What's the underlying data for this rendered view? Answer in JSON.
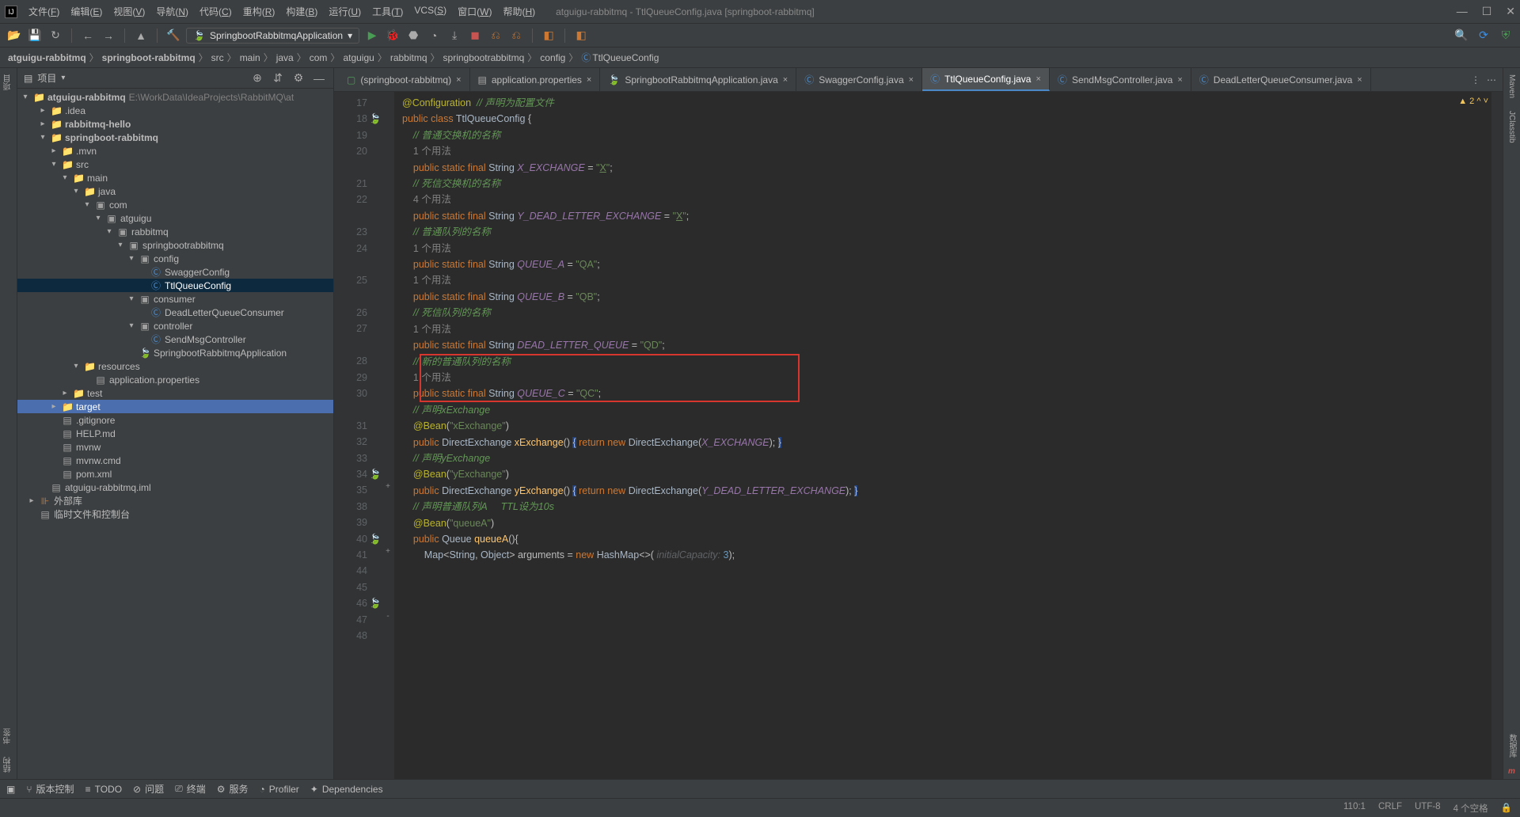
{
  "window": {
    "title": "atguigu-rabbitmq - TtlQueueConfig.java [springboot-rabbitmq]"
  },
  "menus": [
    "文件(F)",
    "编辑(E)",
    "视图(V)",
    "导航(N)",
    "代码(C)",
    "重构(R)",
    "构建(B)",
    "运行(U)",
    "工具(T)",
    "VCS(S)",
    "窗口(W)",
    "帮助(H)"
  ],
  "run_config": "SpringbootRabbitmqApplication",
  "breadcrumb": [
    "atguigu-rabbitmq",
    "springboot-rabbitmq",
    "src",
    "main",
    "java",
    "com",
    "atguigu",
    "rabbitmq",
    "springbootrabbitmq",
    "config",
    "TtlQueueConfig"
  ],
  "left_rail": [
    "项目"
  ],
  "right_rail_top": [
    "Maven",
    "JClasstib"
  ],
  "right_rail_bottom": [
    "数据库",
    "m"
  ],
  "left_rail_bottom": [
    "书签",
    "结构"
  ],
  "tree_title": "项目",
  "tree": {
    "root": {
      "name": "atguigu-rabbitmq",
      "path": "E:\\WorkData\\IdeaProjects\\RabbitMQ\\at"
    },
    "items": [
      {
        "pad": 1,
        "arrow": ">",
        "ictype": "folder",
        "label": ".idea"
      },
      {
        "pad": 1,
        "arrow": ">",
        "ictype": "folder",
        "label": "rabbitmq-hello",
        "bold": true
      },
      {
        "pad": 1,
        "arrow": "v",
        "ictype": "folder",
        "label": "springboot-rabbitmq",
        "bold": true
      },
      {
        "pad": 2,
        "arrow": ">",
        "ictype": "folder",
        "label": ".mvn"
      },
      {
        "pad": 2,
        "arrow": "v",
        "ictype": "folder",
        "label": "src"
      },
      {
        "pad": 3,
        "arrow": "v",
        "ictype": "folder",
        "label": "main"
      },
      {
        "pad": 4,
        "arrow": "v",
        "ictype": "folder",
        "label": "java"
      },
      {
        "pad": 5,
        "arrow": "v",
        "ictype": "pkg",
        "label": "com"
      },
      {
        "pad": 6,
        "arrow": "v",
        "ictype": "pkg",
        "label": "atguigu"
      },
      {
        "pad": 7,
        "arrow": "v",
        "ictype": "pkg",
        "label": "rabbitmq"
      },
      {
        "pad": 8,
        "arrow": "v",
        "ictype": "pkg",
        "label": "springbootrabbitmq"
      },
      {
        "pad": 9,
        "arrow": "v",
        "ictype": "pkg",
        "label": "config"
      },
      {
        "pad": 10,
        "arrow": "",
        "ictype": "cls",
        "label": "SwaggerConfig"
      },
      {
        "pad": 10,
        "arrow": "",
        "ictype": "cls",
        "label": "TtlQueueConfig",
        "sel": true
      },
      {
        "pad": 9,
        "arrow": "v",
        "ictype": "pkg",
        "label": "consumer"
      },
      {
        "pad": 10,
        "arrow": "",
        "ictype": "cls",
        "label": "DeadLetterQueueConsumer"
      },
      {
        "pad": 9,
        "arrow": "v",
        "ictype": "pkg",
        "label": "controller"
      },
      {
        "pad": 10,
        "arrow": "",
        "ictype": "cls",
        "label": "SendMsgController"
      },
      {
        "pad": 9,
        "arrow": "",
        "ictype": "spr",
        "label": "SpringbootRabbitmqApplication"
      },
      {
        "pad": 4,
        "arrow": "v",
        "ictype": "folder",
        "label": "resources"
      },
      {
        "pad": 5,
        "arrow": "",
        "ictype": "file",
        "label": "application.properties"
      },
      {
        "pad": 3,
        "arrow": ">",
        "ictype": "folder",
        "label": "test"
      },
      {
        "pad": 2,
        "arrow": ">",
        "ictype": "folder-o",
        "label": "target",
        "sel2": true
      },
      {
        "pad": 2,
        "arrow": "",
        "ictype": "file",
        "label": ".gitignore"
      },
      {
        "pad": 2,
        "arrow": "",
        "ictype": "file",
        "label": "HELP.md"
      },
      {
        "pad": 2,
        "arrow": "",
        "ictype": "file",
        "label": "mvnw"
      },
      {
        "pad": 2,
        "arrow": "",
        "ictype": "file",
        "label": "mvnw.cmd"
      },
      {
        "pad": 2,
        "arrow": "",
        "ictype": "file",
        "label": "pom.xml",
        "icclr": "#c75450"
      },
      {
        "pad": 1,
        "arrow": "",
        "ictype": "file",
        "label": "atguigu-rabbitmq.iml"
      },
      {
        "pad": 0,
        "arrow": ">",
        "ictype": "lib",
        "label": "外部库"
      },
      {
        "pad": 0,
        "arrow": "",
        "ictype": "file",
        "label": "临时文件和控制台"
      }
    ]
  },
  "tabs": [
    {
      "label": "(springboot-rabbitmq)",
      "icon": "run"
    },
    {
      "label": "application.properties",
      "icon": "file"
    },
    {
      "label": "SpringbootRabbitmqApplication.java",
      "icon": "spr"
    },
    {
      "label": "SwaggerConfig.java",
      "icon": "cls"
    },
    {
      "label": "TtlQueueConfig.java",
      "icon": "cls",
      "active": true
    },
    {
      "label": "SendMsgController.java",
      "icon": "cls"
    },
    {
      "label": "DeadLetterQueueConsumer.java",
      "icon": "cls"
    }
  ],
  "editor": {
    "warn_count": "2",
    "lines": [
      {
        "n": 17,
        "html": "<span class='an'>@Configuration</span>  <span class='cg'>// 声明为配置文件</span>"
      },
      {
        "n": 18,
        "html": "<span class='k'>public</span> <span class='k'>class</span> <span class='clsname'>TtlQueueConfig</span> {",
        "gic": "leaf"
      },
      {
        "n": 19,
        "html": ""
      },
      {
        "n": 20,
        "html": "    <span class='cg'>// 普通交换机的名称</span>"
      },
      {
        "n": "",
        "html": "    <span class='c'>1 个用法</span>"
      },
      {
        "n": 21,
        "html": "    <span class='k'>public</span> <span class='k'>static</span> <span class='k'>final</span> <span class='id'>String</span> <span class='fi'>X_EXCHANGE</span> = <span class='s'>\"<u>X</u>\"</span>;"
      },
      {
        "n": 22,
        "html": "    <span class='cg'>// 死信交换机的名称</span>"
      },
      {
        "n": "",
        "html": "    <span class='c'>4 个用法</span>"
      },
      {
        "n": 23,
        "html": "    <span class='k'>public</span> <span class='k'>static</span> <span class='k'>final</span> <span class='id'>String</span> <span class='fi'>Y_DEAD_LETTER_EXCHANGE</span> = <span class='s'>\"<u>X</u>\"</span>;"
      },
      {
        "n": 24,
        "html": "    <span class='cg'>// 普通队列的名称</span>"
      },
      {
        "n": "",
        "html": "    <span class='c'>1 个用法</span>"
      },
      {
        "n": 25,
        "html": "    <span class='k'>public</span> <span class='k'>static</span> <span class='k'>final</span> <span class='id'>String</span> <span class='fi'>QUEUE_A</span> = <span class='s'>\"QA\"</span>;"
      },
      {
        "n": "",
        "html": "    <span class='c'>1 个用法</span>"
      },
      {
        "n": 26,
        "html": "    <span class='k'>public</span> <span class='k'>static</span> <span class='k'>final</span> <span class='id'>String</span> <span class='fi'>QUEUE_B</span> = <span class='s'>\"QB\"</span>;"
      },
      {
        "n": 27,
        "html": "    <span class='cg'>// 死信队列的名称</span>"
      },
      {
        "n": "",
        "html": "    <span class='c'>1 个用法</span>"
      },
      {
        "n": 28,
        "html": "    <span class='k'>public</span> <span class='k'>static</span> <span class='k'>final</span> <span class='id'>String</span> <span class='fi'>DEAD_LETTER_QUEUE</span> = <span class='s'>\"QD\"</span>;"
      },
      {
        "n": 29,
        "html": ""
      },
      {
        "n": 30,
        "html": "    <span class='cg'>// 新的普通队列的名称</span>",
        "box": "start"
      },
      {
        "n": "",
        "html": "    <span class='c'>1 个用法</span>"
      },
      {
        "n": 31,
        "html": "    <span class='k'>public</span> <span class='k'>static</span> <span class='k'>final</span> <span class='id'>String</span> <span class='fi'>QUEUE_C</span> = <span class='s'>\"QC\"</span>;",
        "box": "end"
      },
      {
        "n": 32,
        "html": ""
      },
      {
        "n": 33,
        "html": "    <span class='cg'>// 声明xExchange</span>"
      },
      {
        "n": 34,
        "html": "    <span class='an'>@Bean</span>(<span class='s'>\"xExchange\"</span>)",
        "gic": "leaf"
      },
      {
        "n": 35,
        "html": "    <span class='k'>public</span> <span class='id'>DirectExchange</span> <span class='an' style='color:#ffc66d'>xExchange</span>() <span class='hl'>{</span> <span class='k'>return</span> <span class='k'>new</span> <span class='id'>DirectExchange</span>(<span class='fi'>X_EXCHANGE</span>); <span class='hl'>}</span>",
        "fold": "+"
      },
      {
        "n": 38,
        "html": ""
      },
      {
        "n": 39,
        "html": "    <span class='cg'>// 声明yExchange</span>"
      },
      {
        "n": 40,
        "html": "    <span class='an'>@Bean</span>(<span class='s'>\"yExchange\"</span>)",
        "gic": "leaf"
      },
      {
        "n": 41,
        "html": "    <span class='k'>public</span> <span class='id'>DirectExchange</span> <span class='an' style='color:#ffc66d'>yExchange</span>() <span class='hl'>{</span> <span class='k'>return</span> <span class='k'>new</span> <span class='id'>DirectExchange</span>(<span class='fi'>Y_DEAD_LETTER_EXCHANGE</span>); <span class='hl'>}</span>",
        "fold": "+"
      },
      {
        "n": 44,
        "html": ""
      },
      {
        "n": 45,
        "html": "    <span class='cg'>// 声明普通队列A     TTL设为10s</span>"
      },
      {
        "n": 46,
        "html": "    <span class='an'>@Bean</span>(<span class='s'>\"queueA\"</span>)",
        "gic": "leaf"
      },
      {
        "n": 47,
        "html": "    <span class='k'>public</span> <span class='id'>Queue</span> <span class='an' style='color:#ffc66d'>queueA</span>(){",
        "fold": "-"
      },
      {
        "n": 48,
        "html": "        <span class='id'>Map</span>&lt;<span class='id'>String</span>, <span class='id'>Object</span>&gt; arguments = <span class='k'>new</span> <span class='id'>HashMap</span>&lt;&gt;( <span class='hint'>initialCapacity:</span> <span class='n'>3</span>);"
      }
    ]
  },
  "bottom_tools": [
    "版本控制",
    "TODO",
    "问题",
    "终端",
    "服务",
    "Profiler",
    "Dependencies"
  ],
  "status": {
    "pos": "110:1",
    "eol": "CRLF",
    "enc": "UTF-8",
    "indent": "4 个空格",
    "lock": "🔒"
  }
}
